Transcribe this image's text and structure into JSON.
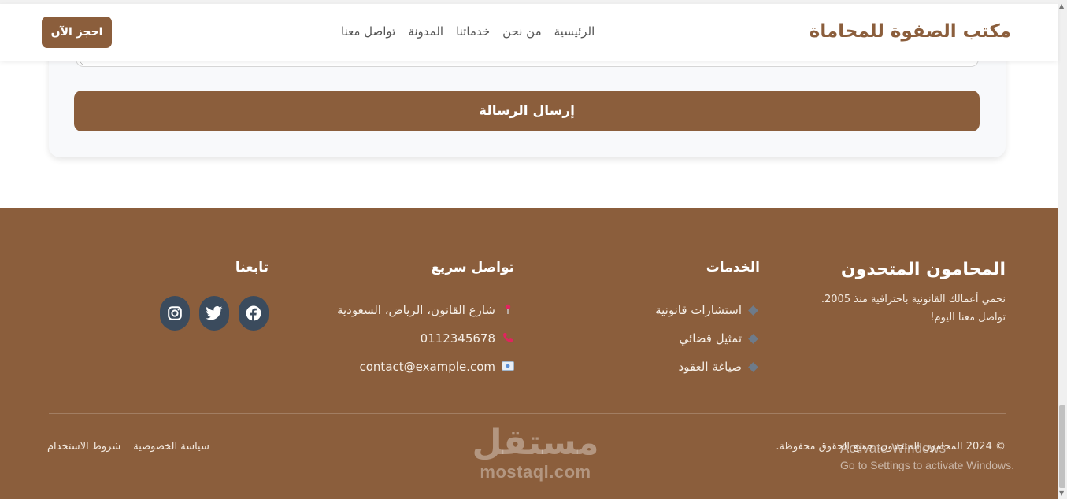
{
  "header": {
    "brand": "مكتب الصفوة للمحاماة",
    "nav": [
      "الرئيسية",
      "من نحن",
      "خدماتنا",
      "المدونة",
      "تواصل معنا"
    ],
    "book_button": "احجز الآن"
  },
  "form": {
    "submit_label": "إرسال الرسالة"
  },
  "footer": {
    "about": {
      "title": "المحامون المتحدون",
      "text_line1": "نحمي أعمالك القانونية باحترافية منذ 2005.",
      "text_line2": "تواصل معنا اليوم!"
    },
    "services": {
      "heading": "الخدمات",
      "items": [
        "استشارات قانونية",
        "تمثيل قضائي",
        "صياغة العقود"
      ]
    },
    "contact": {
      "heading": "تواصل سريع",
      "address": "شارع القانون، الرياض، السعودية",
      "phone": "0112345678",
      "email": "contact@example.com"
    },
    "follow": {
      "heading": "تابعنا",
      "icons": [
        "facebook-icon",
        "twitter-icon",
        "instagram-icon"
      ]
    },
    "copyright": "© 2024 المحامون المتحدون. جميع الحقوق محفوظة.",
    "legal_links": [
      "سياسة الخصوصية",
      "شروط الاستخدام"
    ]
  },
  "watermark": {
    "arabic": "مستقل",
    "latin": "mostaql.com"
  },
  "os_overlay": {
    "title": "Activate Windows",
    "subtitle": "Go to Settings to activate Windows."
  },
  "colors": {
    "brand": "#8b5e3c",
    "social_bg": "#3b4b5d",
    "page_bg": "#ffffff"
  }
}
